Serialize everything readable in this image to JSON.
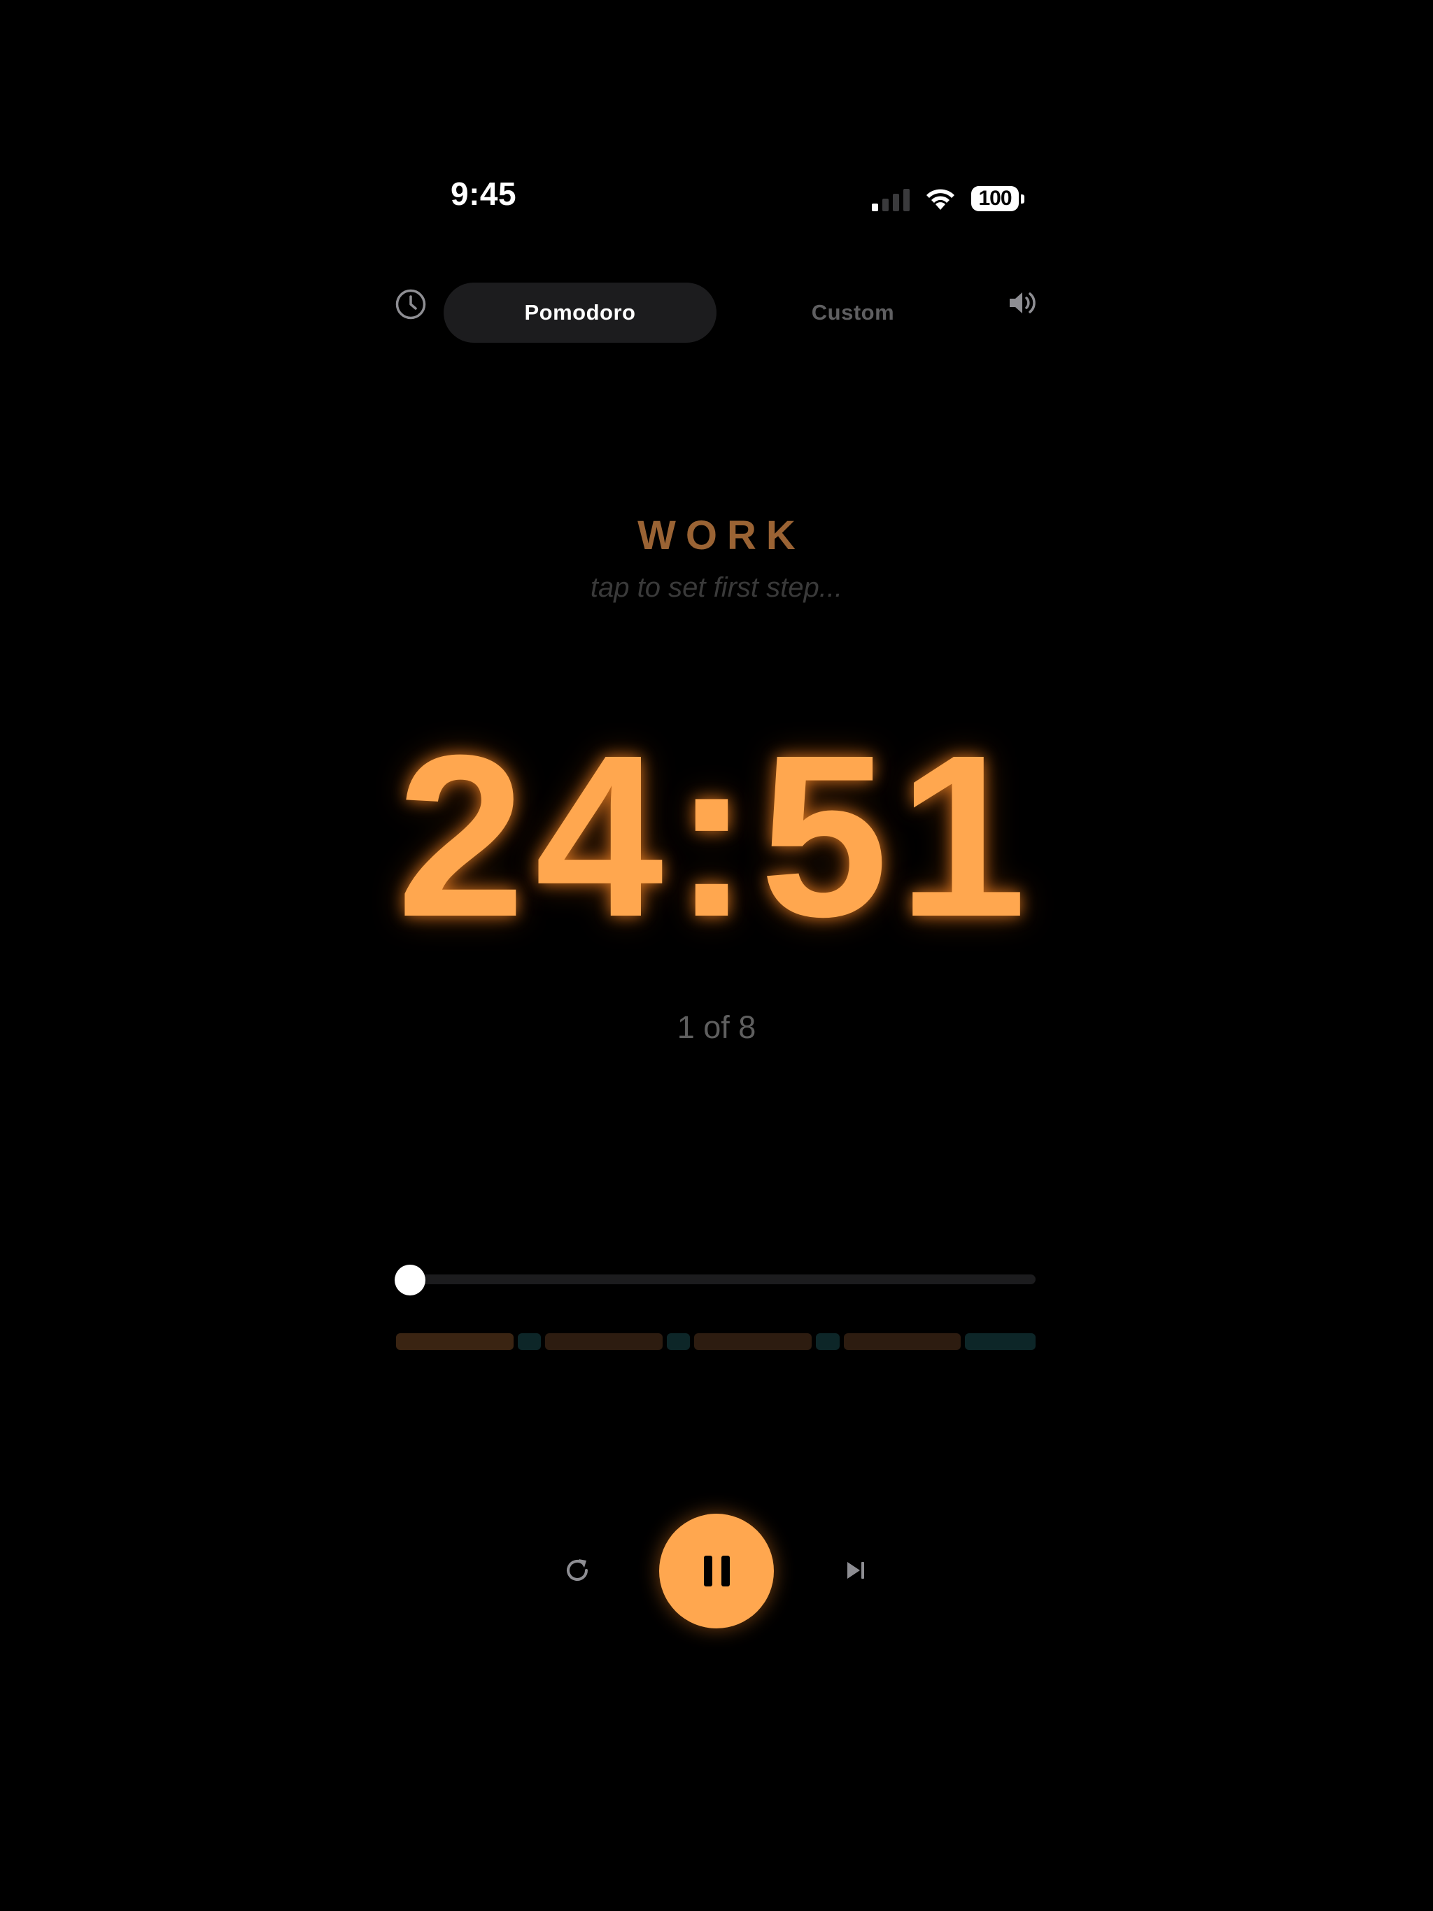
{
  "status_bar": {
    "time": "9:45",
    "battery": "100",
    "signal_bars_active": 1,
    "signal_bars_total": 4
  },
  "modes": {
    "tabs": [
      {
        "label": "Pomodoro",
        "active": true
      },
      {
        "label": "Custom",
        "active": false
      }
    ]
  },
  "icons": {
    "history": "clock-icon",
    "sound": "speaker-icon",
    "restart": "restart-icon",
    "pause": "pause-icon",
    "skip": "skip-next-icon"
  },
  "phase": {
    "label": "WORK",
    "hint": "tap to set first step..."
  },
  "timer": {
    "display": "24:51"
  },
  "round": {
    "text": "1 of 8"
  },
  "progress": {
    "fraction": 0.02
  },
  "schedule": {
    "segments": [
      {
        "type": "work",
        "minutes": 25
      },
      {
        "type": "short-break",
        "minutes": 5
      },
      {
        "type": "work",
        "minutes": 25
      },
      {
        "type": "short-break",
        "minutes": 5
      },
      {
        "type": "work",
        "minutes": 25
      },
      {
        "type": "short-break",
        "minutes": 5
      },
      {
        "type": "work",
        "minutes": 25
      },
      {
        "type": "long-break",
        "minutes": 15
      }
    ],
    "current_index": 0
  },
  "colors": {
    "accent": "#ffa74f",
    "background": "#000000",
    "phase_label": "#9a6334",
    "work_segment": "#2d1c10",
    "break_segment": "#0d2628"
  }
}
